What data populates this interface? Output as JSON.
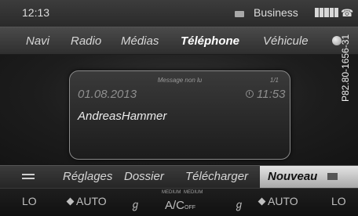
{
  "status_bar": {
    "time": "12:13",
    "message_icon": "envelope-icon",
    "operator": "Business",
    "signal_icon": "signal-bars-icon",
    "phone_icon": "phone-icon"
  },
  "main_menu": {
    "items": [
      "Navi",
      "Radio",
      "Médias",
      "Téléphone",
      "Véhicule"
    ],
    "active": "Téléphone",
    "globe_icon": "globe-icon"
  },
  "message": {
    "status": "Message non lu",
    "counter": "1/1",
    "date": "01.08.2013",
    "time": "11:53",
    "sender": "AndreasHammer"
  },
  "submenu": {
    "back_icon": "back-icon",
    "items": [
      "Réglages",
      "Dossier",
      "Télécharger"
    ],
    "active_label": "Nouveau",
    "active_icon": "envelope-icon"
  },
  "climate": {
    "left_temp": "LO",
    "left_fan": "AUTO",
    "medium_left": "MEDIUM",
    "medium_right": "MEDIUM",
    "ac_label": "A/C",
    "ac_state": "OFF",
    "right_fan": "AUTO",
    "right_temp": "LO"
  },
  "figure_code": "P82.80-1656-31",
  "colors": {
    "active_bg": "#d0d0d0",
    "bar_bg": "#2f2f2f",
    "text": "#e6e6e6"
  }
}
